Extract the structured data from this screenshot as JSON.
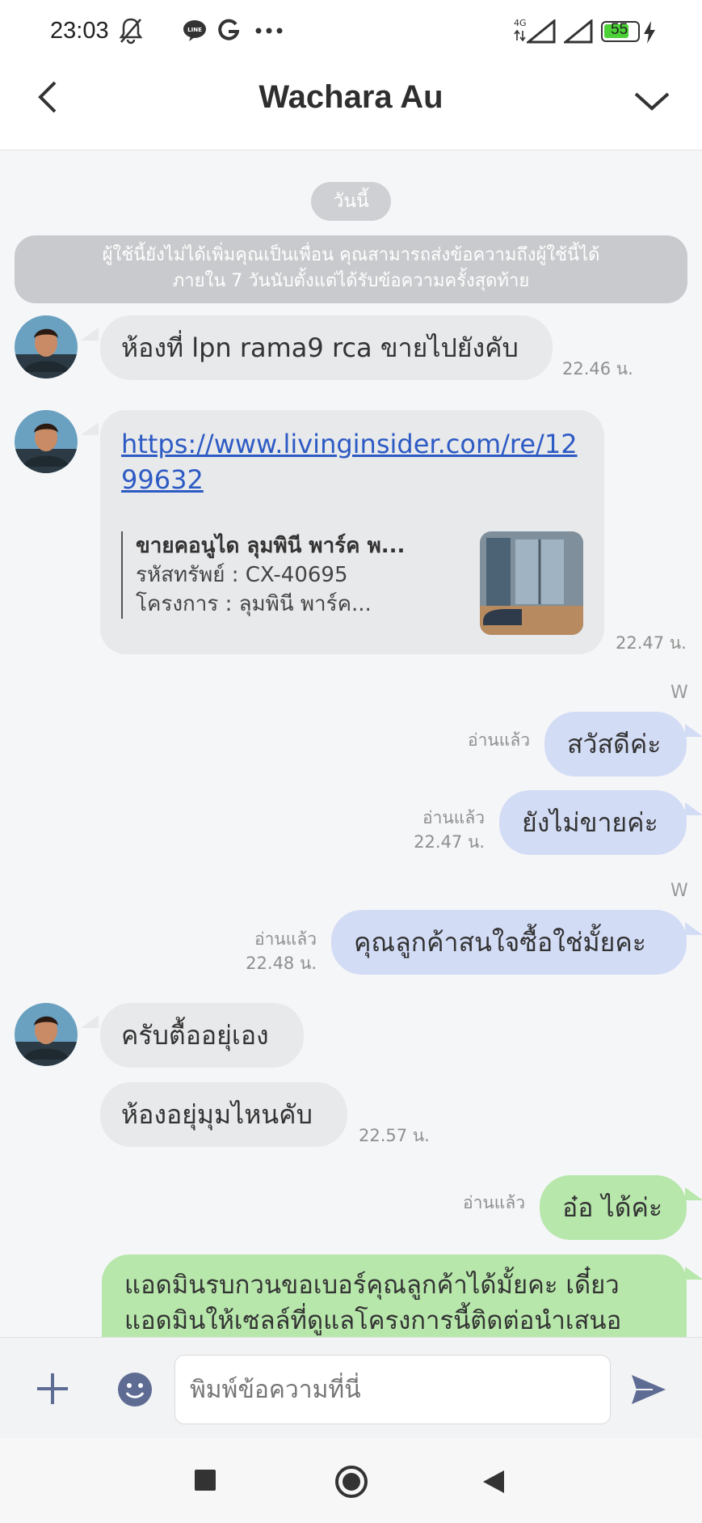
{
  "status_bar": {
    "time": "23:03",
    "battery": "55",
    "network": "4G"
  },
  "header": {
    "title": "Wachara Au"
  },
  "chat": {
    "date_label": "วันนี้",
    "system_note_line1": "ผู้ใช้นี้ยังไม่ได้เพิ่มคุณเป็นเพื่อน คุณสามารถส่งข้อความถึงผู้ใช้นี้ได้",
    "system_note_line2": "ภายใน 7 วันนับตั้งแต่ได้รับข้อความครั้งสุดท้าย",
    "messages": [
      {
        "text": "ห้องที่ lpn rama9 rca ขายไปยังคับ",
        "time": "22.46 น."
      },
      {
        "link": "https://www.livinginsider.com/re/1299632",
        "preview_title": "ขายคอนูได ลุมพินี พาร์ค พ...",
        "preview_code": "รหัสทรัพย์ : CX-40695",
        "preview_project": "โครงการ : ลุมพินี พาร์ค...",
        "time": "22.47 น."
      },
      {
        "sender": "W",
        "text": "สวัสดีค่ะ",
        "status": "อ่านแล้ว"
      },
      {
        "text": "ยังไม่ขายค่ะ",
        "status": "อ่านแล้ว",
        "time": "22.47 น."
      },
      {
        "sender": "W",
        "text": "คุณลูกค้าสนใจซื้อใช่มั้ยคะ",
        "status": "อ่านแล้ว",
        "time": "22.48 น."
      },
      {
        "text": "ครับตื้ออยุ่เอง"
      },
      {
        "text": "ห้องอยุ่มุมไหนคับ",
        "time": "22.57 น."
      },
      {
        "text": "อ๋อ ได้ค่ะ",
        "status": "อ่านแล้ว"
      },
      {
        "line1": "แอดมินรบกวนขอเบอร์คุณลูกค้าได้มั้ยคะ เดี๋ยว",
        "line2": "แอดมินให้เซลล์ที่ดูแลโครงการนี้ติดต่อนำเสนอ"
      }
    ]
  },
  "input": {
    "placeholder": "พิมพ์ข้อความที่นี่"
  },
  "icons": {
    "back": "chevron-left-icon",
    "dropdown": "chevron-down-icon",
    "plus": "plus-icon",
    "emoji": "smiley-icon",
    "send": "send-icon",
    "recent": "square-icon",
    "home": "circle-icon",
    "nav_back": "triangle-icon"
  },
  "colors": {
    "incoming_bubble": "#e8e9eb",
    "outgoing_bubble": "#d3dcf5",
    "green_bubble": "#b7e7ab",
    "link": "#2d5bc4",
    "accent": "#5e6b93"
  }
}
